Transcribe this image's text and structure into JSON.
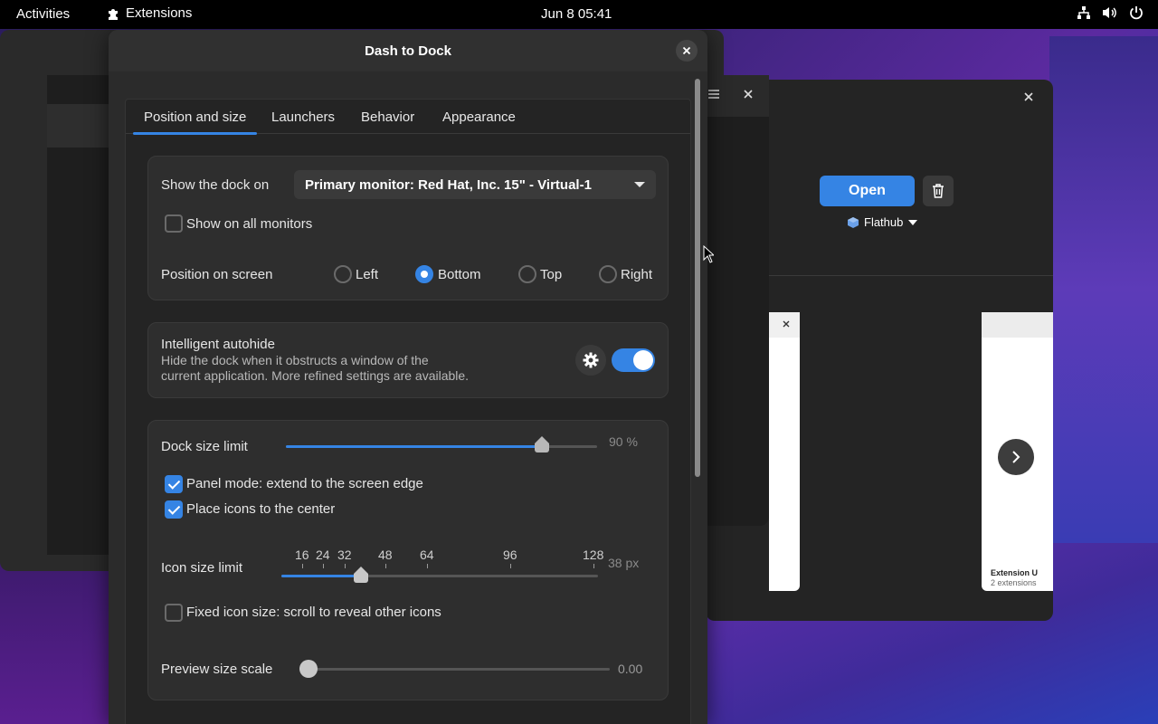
{
  "topbar": {
    "activities": "Activities",
    "app_name": "Extensions",
    "clock": "Jun 8  05:41"
  },
  "background_window": {
    "open_label": "Open",
    "source_label": "Flathub",
    "footer_title": "Extension U",
    "footer_sub": "2 extensions"
  },
  "dialog": {
    "title": "Dash to Dock",
    "tabs": [
      "Position and size",
      "Launchers",
      "Behavior",
      "Appearance"
    ],
    "active_tab": 0,
    "show_dock_on_label": "Show the dock on",
    "monitor_value": "Primary monitor: Red Hat, Inc. 15\" - Virtual-1",
    "show_all_monitors": "Show on all monitors",
    "position_label": "Position on screen",
    "positions": [
      "Left",
      "Bottom",
      "Top",
      "Right"
    ],
    "selected_position": "Bottom",
    "autohide_title": "Intelligent autohide",
    "autohide_desc_1": "Hide the dock when it obstructs a window of the",
    "autohide_desc_2": "current application. More refined settings are available.",
    "autohide_enabled": true,
    "dock_size_label": "Dock size limit",
    "dock_size_value": "90 %",
    "dock_size_fraction": 0.9,
    "panel_mode": "Panel mode: extend to the screen edge",
    "panel_mode_checked": true,
    "center_icons": "Place icons to the center",
    "center_icons_checked": true,
    "icon_size_label": "Icon size limit",
    "icon_size_ticks": [
      "16",
      "24",
      "32",
      "48",
      "64",
      "96",
      "128"
    ],
    "icon_size_value": "38 px",
    "fixed_icon": "Fixed icon size: scroll to reveal other icons",
    "fixed_icon_checked": false,
    "preview_label": "Preview size scale",
    "preview_value": "0.00"
  },
  "colors": {
    "accent": "#3584e4",
    "dialog_bg": "#2b2b2b",
    "group_bg": "#2e2e2e"
  }
}
